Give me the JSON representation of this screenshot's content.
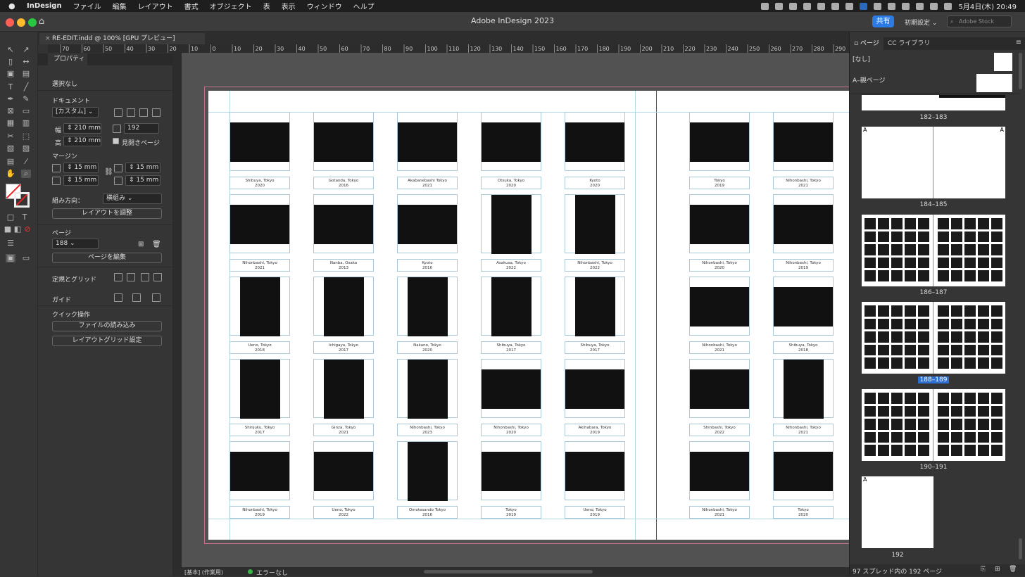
{
  "menubar": {
    "apple": "",
    "app": "InDesign",
    "items": [
      "ファイル",
      "編集",
      "レイアウト",
      "書式",
      "オブジェクト",
      "表",
      "表示",
      "ウィンドウ",
      "ヘルプ"
    ],
    "clock": "5月4日(木) 20:49"
  },
  "window": {
    "title": "Adobe InDesign 2023",
    "share": "共有",
    "workspace": "初期設定",
    "stock_placeholder": "Adobe Stock"
  },
  "document_tab": {
    "label": "RE-EDIT.indd @ 100% [GPU プレビュー]"
  },
  "ruler_labels": [
    "70",
    "60",
    "50",
    "40",
    "30",
    "20",
    "10",
    "0",
    "10",
    "20",
    "30",
    "40",
    "50",
    "60",
    "70",
    "80",
    "90",
    "100",
    "110",
    "120",
    "130",
    "140",
    "150",
    "160",
    "170",
    "180",
    "190",
    "200",
    "210",
    "220",
    "230",
    "240",
    "250",
    "260",
    "270",
    "280",
    "290"
  ],
  "properties": {
    "tab": "プロパティ",
    "selection": "選択なし",
    "document_section": "ドキュメント",
    "preset": "[カスタム]",
    "width_label": "幅",
    "width": "210 mm",
    "height_label": "高",
    "height": "210 mm",
    "pages": "192",
    "facing": "見開きページ",
    "margin_section": "マージン",
    "margin_top": "15 mm",
    "margin_bottom": "15 mm",
    "margin_left": "15 mm",
    "margin_right": "15 mm",
    "binding_label": "組み方向：",
    "binding": "横組み",
    "adjust_layout": "レイアウトを調整",
    "page_section": "ページ",
    "page_value": "188",
    "edit_page": "ページを編集",
    "rulers_grid": "定規とグリッド",
    "guides": "ガイド",
    "quick_actions": "クイック操作",
    "import_file": "ファイルの読み込み",
    "layout_grid": "レイアウトグリッド設定"
  },
  "spread": {
    "left_page": [
      [
        "Shibuya, Tokyo|2020",
        "Gotanda, Tokyo|2016",
        "Akabanebashi Tokyo|2021",
        "Otsuka, Tokyo|2020",
        "Kyoto|2020"
      ],
      [
        "Nihonbashi, Tokyo|2021",
        "Nanba, Osaka|2013",
        "Kyoto|2016",
        "Asakusa, Tokyo|2022",
        "Nihonbashi, Tokyo|2022"
      ],
      [
        "Ueno, Tokyo|2018",
        "Ichigaya, Tokyo|2017",
        "Nakano, Tokyo|2020",
        "Shibuya, Tokyo|2017",
        "Shibuya, Tokyo|2017"
      ],
      [
        "Shinjuku, Tokyo|2017",
        "Ginza, Tokyo|2021",
        "Nihonbashi, Tokyo|2023",
        "Nihonbashi, Tokyo|2020",
        "Akihabara, Tokyo|2019"
      ],
      [
        "Nihonbashi, Tokyo|2019",
        "Ueno, Tokyo|2022",
        "Omotesando Tokyo|2016",
        "Tokyo|2019",
        "Ueno, Tokyo|2019"
      ]
    ],
    "right_page": [
      [
        "Tokyo|2019",
        "Nihonbashi, Tokyo|2021"
      ],
      [
        "Nihonbashi, Tokyo|2020",
        "Nihonbashi, Tokyo|2019"
      ],
      [
        "Nihonbashi, Tokyo|2021",
        "Shibuya, Tokyo|2018"
      ],
      [
        "Shinbashi, Tokyo|2022",
        "Nihonbashi, Tokyo|2021"
      ],
      [
        "Nihonbashi, Tokyo|2021",
        "Tokyo|2020"
      ]
    ]
  },
  "status": {
    "preset": "[基本] (作業用)",
    "errors": "エラーなし"
  },
  "pages_panel": {
    "tab_pages": "ページ",
    "tab_cc": "CC ライブラリ",
    "none_master": "[なし]",
    "a_master": "A–親ページ",
    "spreads": [
      "182–183",
      "184–185",
      "186–187",
      "188–189",
      "190–191",
      "192"
    ],
    "selected": "188–189",
    "master_prefix": "A",
    "footer": "97 スプレッド内の 192 ページ"
  },
  "colors": {
    "accent": "#2c7be5",
    "selection": "#2c6fd1",
    "bleed": "#c5738b",
    "guide": "#a9c9d9"
  }
}
